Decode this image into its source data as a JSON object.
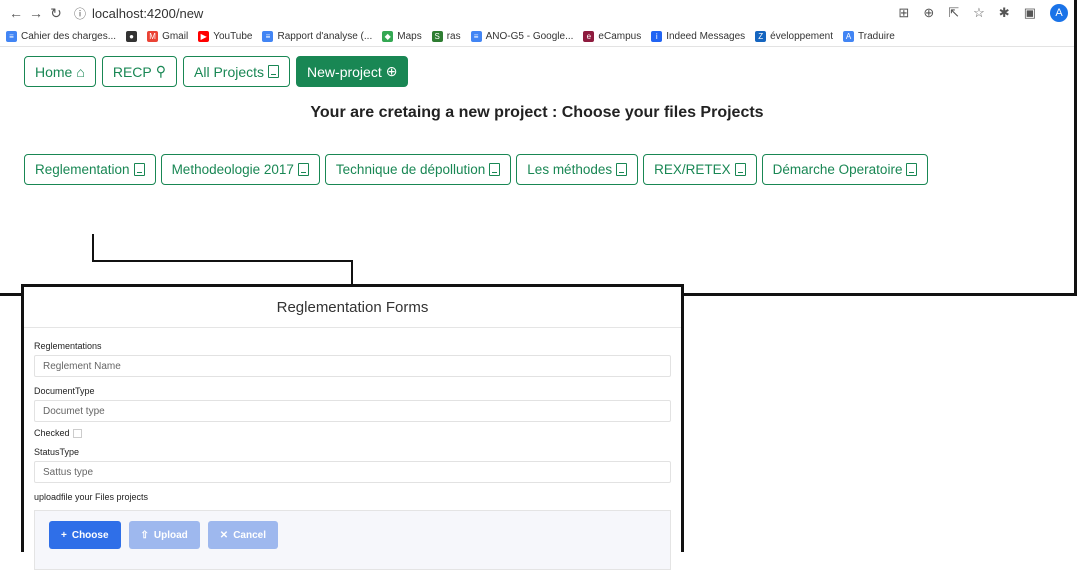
{
  "browser": {
    "url": "localhost:4200/new",
    "avatar_letter": "A",
    "bookmarks": [
      {
        "label": "Cahier des charges...",
        "icon": "doc-icon",
        "color": "#4285f4",
        "glyph": "≡"
      },
      {
        "label": "",
        "icon": "github-icon",
        "color": "#333333",
        "glyph": "●"
      },
      {
        "label": "Gmail",
        "icon": "gmail-icon",
        "color": "#ea4335",
        "glyph": "M"
      },
      {
        "label": "YouTube",
        "icon": "youtube-icon",
        "color": "#ff0000",
        "glyph": "▶"
      },
      {
        "label": "Rapport d'analyse (...",
        "icon": "doc-icon",
        "color": "#4285f4",
        "glyph": "≡"
      },
      {
        "label": "Maps",
        "icon": "maps-icon",
        "color": "#34a853",
        "glyph": "◆"
      },
      {
        "label": "ras",
        "icon": "ras-icon",
        "color": "#2e7d32",
        "glyph": "S"
      },
      {
        "label": "ANO-G5 - Google...",
        "icon": "doc-icon",
        "color": "#4285f4",
        "glyph": "≡"
      },
      {
        "label": "eCampus",
        "icon": "ecampus-icon",
        "color": "#8e1b3e",
        "glyph": "e"
      },
      {
        "label": "Indeed Messages",
        "icon": "indeed-icon",
        "color": "#2164f3",
        "glyph": "i"
      },
      {
        "label": "éveloppement",
        "icon": "z-icon",
        "color": "#1565c0",
        "glyph": "Z"
      },
      {
        "label": "Traduire",
        "icon": "translate-icon",
        "color": "#4285f4",
        "glyph": "A"
      }
    ]
  },
  "nav": {
    "home": "Home",
    "recp": "RECP",
    "all_projects": "All Projects",
    "new_project": "New-project"
  },
  "heading": "Your are cretaing a new project : Choose your files Projects",
  "categories": [
    "Reglementation",
    "Methodeologie 2017",
    "Technique de dépollution",
    "Les méthodes",
    "REX/RETEX",
    "Démarche Operatoire"
  ],
  "form": {
    "title": "Reglementation Forms",
    "reglementations_label": "Reglementations",
    "reglementations_placeholder": "Reglement Name",
    "documenttype_label": "DocumentType",
    "documenttype_placeholder": "Documet type",
    "checked_label": "Checked",
    "statustype_label": "StatusType",
    "statustype_placeholder": "Sattus type",
    "upload_label": "uploadfile your Files projects",
    "choose": "Choose",
    "upload": "Upload",
    "cancel": "Cancel"
  },
  "colors": {
    "accent_green": "#198754",
    "primary_blue": "#2f6fe8"
  }
}
